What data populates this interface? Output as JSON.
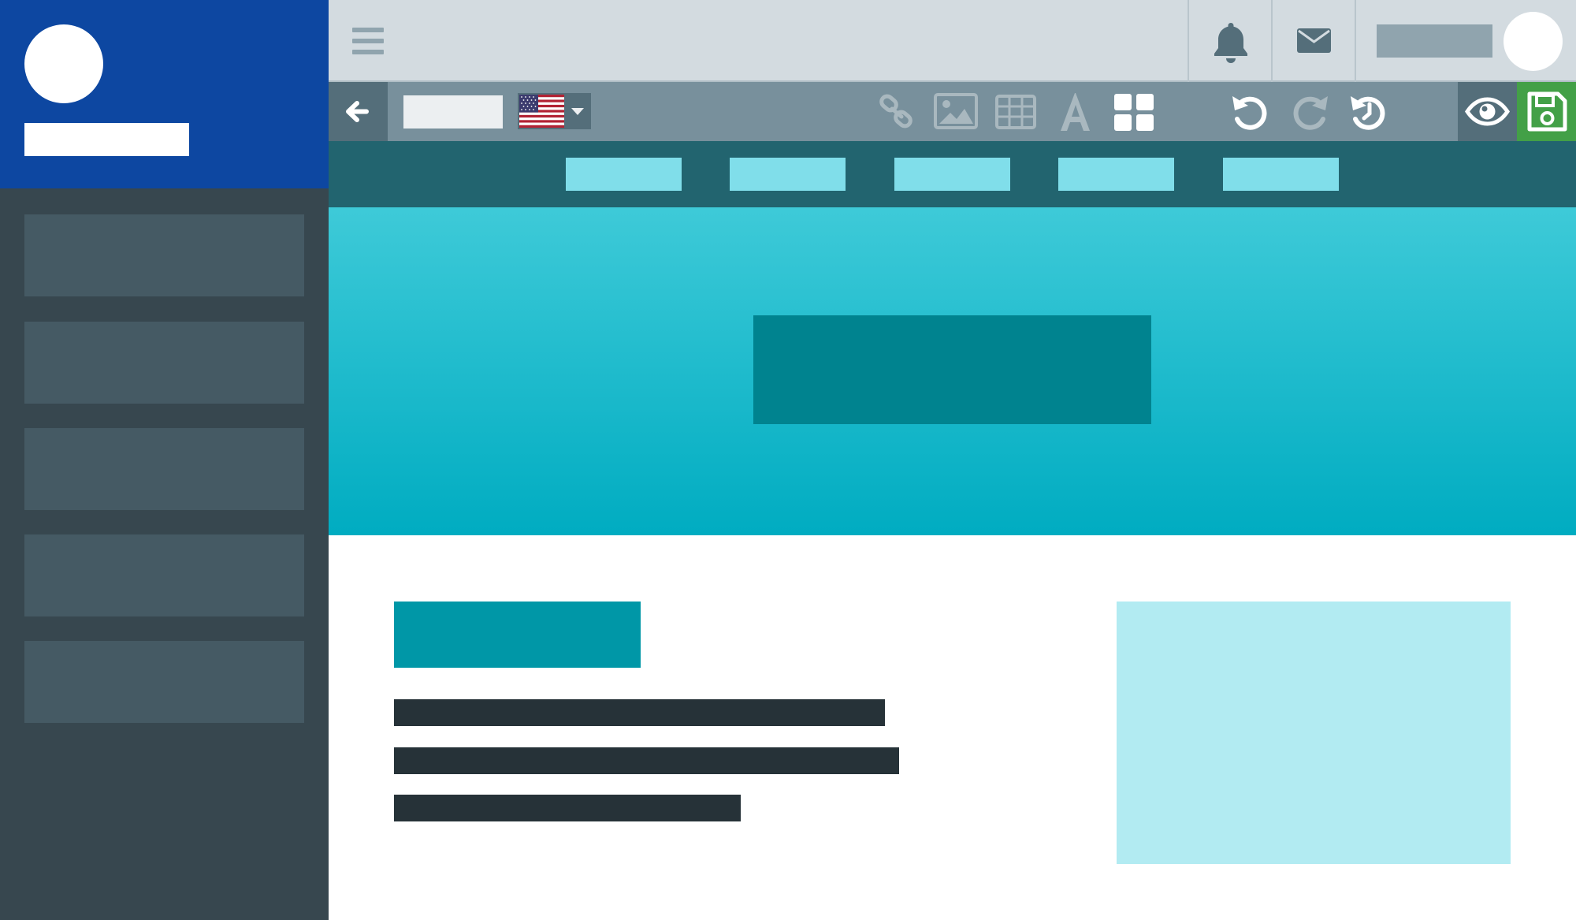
{
  "app": {
    "title": ""
  },
  "sidebar": {
    "user_name": "",
    "items": [
      {
        "label": ""
      },
      {
        "label": ""
      },
      {
        "label": ""
      },
      {
        "label": ""
      },
      {
        "label": ""
      }
    ]
  },
  "topbar": {
    "menu_icon": "hamburger-icon",
    "notifications_icon": "bell-icon",
    "messages_icon": "envelope-icon",
    "user_name": ""
  },
  "toolbar": {
    "back_icon": "arrow-left-icon",
    "page_field_value": "",
    "language_flag": "us-flag",
    "tools": [
      {
        "name": "link-icon",
        "enabled": false
      },
      {
        "name": "image-icon",
        "enabled": false
      },
      {
        "name": "table-icon",
        "enabled": false
      },
      {
        "name": "font-icon",
        "enabled": false
      },
      {
        "name": "blocks-icon",
        "enabled": true
      }
    ],
    "history": [
      {
        "name": "undo-icon",
        "enabled": true
      },
      {
        "name": "redo-icon",
        "enabled": false
      },
      {
        "name": "history-icon",
        "enabled": true
      }
    ],
    "preview_icon": "eye-icon",
    "save_icon": "floppy-disk-icon"
  },
  "site": {
    "nav_links": [
      "",
      "",
      "",
      "",
      ""
    ],
    "hero_cta_label": "",
    "section_heading": "",
    "paragraph_lines": [
      "",
      "",
      ""
    ]
  },
  "colors": {
    "sidebar_header": "#0d47a1",
    "sidebar": "#37474f",
    "topbar": "#d3dbe0",
    "toolbar": "#78909c",
    "site_nav": "#22646f",
    "hero_top": "#3ecad8",
    "hero_bottom": "#00acc1",
    "save_button": "#43a047",
    "accent": "#0097a7"
  }
}
